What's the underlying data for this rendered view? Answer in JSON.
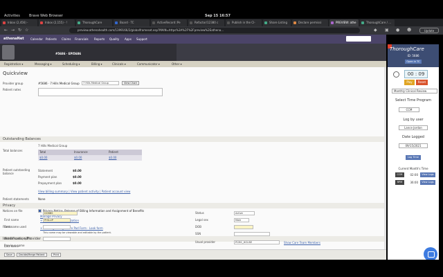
{
  "desktop": {
    "activities": "Activities",
    "app_name": "Brave Web Browser",
    "clock": "Sep 15 16:57"
  },
  "browser": {
    "tabs": [
      {
        "label": "Inbox (2,456) -",
        "color": "#d44"
      },
      {
        "label": "Inbox (2,155) - !",
        "color": "#d44"
      },
      {
        "label": "ThoroughCare",
        "color": "#4a8"
      },
      {
        "label": "Board · TC",
        "color": "#36c"
      },
      {
        "label": "ActiveRecord::Pe",
        "color": "#555"
      },
      {
        "label": "Refactor/12380 c",
        "color": "#555"
      },
      {
        "label": "Publish in the CI-",
        "color": "#555"
      },
      {
        "label": "Share Listing",
        "color": "#4a8"
      },
      {
        "label": "Declare permissi",
        "color": "#d84"
      },
      {
        "label": "PREVIEW: athe",
        "color": "#a6c"
      },
      {
        "label": "ThoroughCare / ...",
        "color": "#4a8"
      }
    ],
    "url": "preview.athenahealth.com/1399166/2/globalframeset.esp?MAIN=https%3A%2F%2Fpreview%2Eathena...",
    "update_label": "Update"
  },
  "athena": {
    "logo": "athenaNet",
    "nav": [
      "Calendar",
      "Patients",
      "Claims",
      "Financials",
      "Reports",
      "Quality",
      "Apps",
      "Support"
    ],
    "patient_ids": "#5686 · EPI5686",
    "subnav": [
      "Registration ▾",
      "Messaging ▾",
      "Scheduling ▾",
      "Billing ▾",
      "Clinicals ▾",
      "Communicator ▾",
      "Other ▾"
    ],
    "title": "Quickview",
    "provider_group_label": "Provider group",
    "provider_group_value": "#5686 · 7 Hills Medical Group",
    "provider_group_select": "7 Hills Medical Group",
    "view_chart": "View Chart",
    "patient_notes_label": "Patient notes",
    "outstanding_section": "Outstanding Balances",
    "group_name": "7 Hills Medical Group",
    "total_balances_label": "Total balances",
    "balance_headers": [
      "Total",
      "Insurance",
      "Patient"
    ],
    "balance_values": [
      "$0.00",
      "$0.00",
      "$0.00"
    ],
    "patient_outstanding_label": "Patient outstanding balance",
    "statement_label": "Statement",
    "statement_value": "$0.00",
    "payment_plan_label": "Payment plan",
    "payment_plan_value": "$0.00",
    "prepayment_plan_label": "Prepayment plan",
    "prepayment_plan_value": "$0.00",
    "billing_links": "View billing summary | View patient activity | Patient account view",
    "patient_statements_label": "Patient statements",
    "patient_statements_value": "None",
    "privacy_section": "Privacy",
    "notices_label": "Notices on file",
    "notices_value": "Privacy Notice, Release of Billing Information and Assignment of Benefits",
    "manage_privacy": "Manage Privacy",
    "add_release": "+ Add release authorization",
    "forms_label": "Forms",
    "forms_link": "+ Add Digital Signature Pad Form · Look form",
    "identification_section": "Identification/Provider",
    "last_name_label": "Last name",
    "last_name_value": "DOBBS",
    "first_name_label": "First name",
    "first_name_value": "PHILLIP",
    "first_name_used_label": "First name used",
    "name_note": "This name may be viewable and editable by the patient.",
    "middle_name_label": "Middle name, suffix",
    "previous_name_label": "Previous name",
    "status_label": "Status",
    "status_value": "Active",
    "legal_sex_label": "Legal sex",
    "legal_sex_value": "Male",
    "dob_label": "DOB",
    "ssn_label": "SSN",
    "usual_provider_label": "Usual provider",
    "usual_provider_value": "PCMC_HOUSE",
    "show_care_team": "Show Care Team Members",
    "bottom_buttons": [
      "Save",
      "Decide/Merge Patient",
      "Print"
    ]
  },
  "panel": {
    "brand": "ThoroughCare",
    "patient_id": "ID: 5686",
    "open_in_tc": "Open in TC",
    "timer": "00 : 09",
    "play": "Play",
    "reset": "Reset",
    "review_select": "Monthly Clinical Review",
    "select_program": "Select Time Program",
    "program_value": "CCM",
    "log_by_user": "Log by user",
    "user_value": "Lance Jordan",
    "date_logged": "Date Logged",
    "date_value": "09/15/2021",
    "log_time": "Log Time",
    "current_month": "Current Month's Time",
    "rows": [
      {
        "tag": "CCM",
        "time": "02:00",
        "action": "View Logs"
      },
      {
        "tag": "RPM",
        "time": "36:00",
        "action": "View Logs"
      }
    ]
  }
}
